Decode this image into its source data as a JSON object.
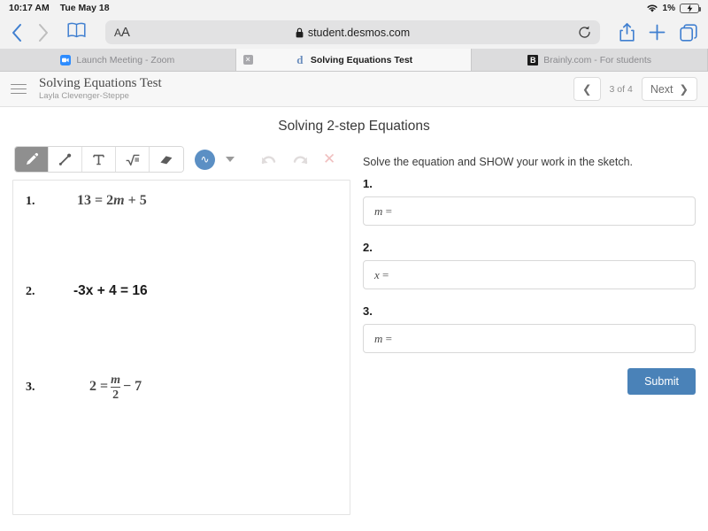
{
  "status_bar": {
    "time": "10:17 AM",
    "date": "Tue May 18",
    "wifi_icon": "wifi-icon",
    "battery_percent": "1%",
    "battery_icon": "battery-charging-icon"
  },
  "browser": {
    "back_icon": "chevron-left-icon",
    "forward_icon": "chevron-right-icon",
    "bookmarks_icon": "book-icon",
    "text_size_label": "A",
    "text_size_label_big": "A",
    "lock_icon": "lock-icon",
    "url": "student.desmos.com",
    "reload_icon": "reload-icon",
    "share_icon": "share-icon",
    "new_tab_icon": "plus-icon",
    "tabs_overview_icon": "tabs-icon",
    "tabs": [
      {
        "title": "Launch Meeting - Zoom",
        "favicon": "zoom-favicon",
        "favicon_glyph": "▶",
        "active": false,
        "has_close": false
      },
      {
        "title": "Solving Equations Test",
        "favicon": "desmos-favicon",
        "favicon_glyph": "d",
        "active": true,
        "has_close": true,
        "close_glyph": "×"
      },
      {
        "title": "Brainly.com - For students",
        "favicon": "brainly-favicon",
        "favicon_glyph": "B",
        "active": false,
        "has_close": false
      }
    ]
  },
  "app_header": {
    "menu_icon": "hamburger-menu-icon",
    "activity_title": "Solving Equations Test",
    "author": "Layla Clevenger-Steppe",
    "prev_icon": "❮",
    "page_count": "3 of 4",
    "next_label": "Next",
    "next_icon": "❯"
  },
  "screen": {
    "title": "Solving 2-step Equations"
  },
  "sketch": {
    "tools": [
      {
        "name": "pencil-tool",
        "glyph": "✎",
        "selected": true
      },
      {
        "name": "line-tool",
        "glyph": "╱",
        "selected": false
      },
      {
        "name": "text-tool",
        "glyph": "T",
        "selected": false
      },
      {
        "name": "math-tool",
        "glyph": "√",
        "selected": false
      },
      {
        "name": "eraser-tool",
        "glyph": "▰",
        "selected": false
      }
    ],
    "color_badge": {
      "name": "pen-color-badge",
      "glyph": "∿",
      "color": "#5b8fc4"
    },
    "color_dropdown_icon": "chevron-down-icon",
    "history": [
      {
        "name": "undo-button",
        "glyph": "↶"
      },
      {
        "name": "redo-button",
        "glyph": "↷"
      },
      {
        "name": "clear-button",
        "glyph": "✕"
      }
    ],
    "equations": [
      {
        "number": "1.",
        "style": "serif",
        "parts": [
          {
            "t": "13 = 2"
          },
          {
            "t": "m",
            "italic": true
          },
          {
            "t": " + 5"
          }
        ]
      },
      {
        "number": "2.",
        "style": "plain",
        "parts": [
          {
            "t": "-3x + 4 = 16"
          }
        ]
      },
      {
        "number": "3.",
        "style": "serif",
        "fraction": {
          "lead": "2 = ",
          "numerator": "m",
          "denominator": "2",
          "trail": " − 7"
        }
      }
    ]
  },
  "questions": {
    "prompt": "Solve the equation and SHOW your work in the sketch.",
    "items": [
      {
        "label": "1.",
        "value": "",
        "prefix_var": "m",
        "prefix_eq": "=",
        "placeholder": ""
      },
      {
        "label": "2.",
        "value": "",
        "prefix_var": "x",
        "prefix_eq": "=",
        "placeholder": ""
      },
      {
        "label": "3.",
        "value": "",
        "prefix_var": "m",
        "prefix_eq": "=",
        "placeholder": ""
      }
    ],
    "submit_label": "Submit",
    "submit_color": "#4a82b8"
  }
}
